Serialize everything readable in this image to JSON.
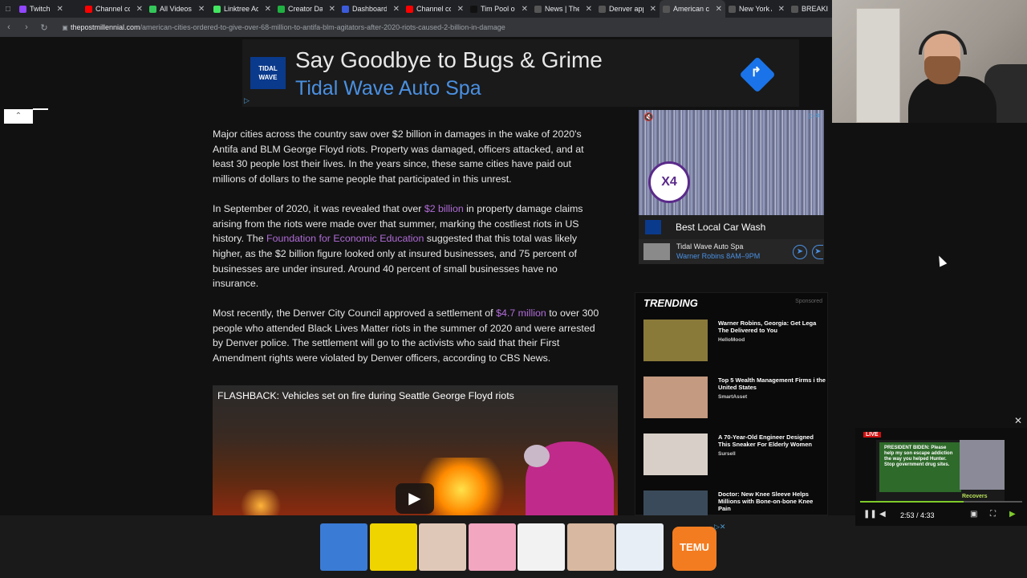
{
  "tabs": [
    {
      "label": "Twitch",
      "color": "#9146ff"
    },
    {
      "label": "Channel co",
      "color": "#ff0000"
    },
    {
      "label": "All Videos",
      "color": "#34c759"
    },
    {
      "label": "Linktree Ad",
      "color": "#43e660"
    },
    {
      "label": "Creator Da",
      "color": "#1fb141"
    },
    {
      "label": "Dashboard",
      "color": "#3b5bdb"
    },
    {
      "label": "Channel co",
      "color": "#ff0000"
    },
    {
      "label": "Tim Pool or",
      "color": "#111111"
    },
    {
      "label": "News | The",
      "color": "#555555"
    },
    {
      "label": "Denver app",
      "color": "#555555"
    },
    {
      "label": "American c",
      "color": "#555555",
      "active": true
    },
    {
      "label": "New York A",
      "color": "#555555"
    },
    {
      "label": "BREAKI",
      "color": "#555555"
    }
  ],
  "url": {
    "domain": "thepostmillennial.com",
    "path": "/american-cities-ordered-to-give-over-68-million-to-antifa-blm-agitators-after-2020-riots-caused-2-billion-in-damage"
  },
  "top_ad": {
    "logo": "TIDAL WAVE",
    "headline": "Say Goodbye to Bugs & Grime",
    "brand": "Tidal Wave Auto Spa",
    "arrow": "↱"
  },
  "article": {
    "p1": "Major cities across the country saw over $2 billion in damages in the wake of 2020's Antifa and BLM George Floyd riots. Property was damaged, officers attacked, and at least 30 people lost their lives. In the years since, these same cities have paid out millions of dollars to the same people that participated in this unrest.",
    "p2_a": "In September of 2020, it was revealed that over ",
    "p2_link1": "$2 billion",
    "p2_b": " in property damage claims arising from the riots were made over that summer, marking the costliest riots in US history. The ",
    "p2_link2": "Foundation for Economic Education",
    "p2_c": " suggested that this total was likely higher, as the $2 billion figure looked only at insured businesses, and 75 percent of businesses are under insured. Around 40 percent of small businesses have no insurance.",
    "p3_a": "Most recently, the Denver City Council approved a settlement of ",
    "p3_link": "$4.7 million",
    "p3_b": " to over 300 people who attended Black Lives Matter riots in the summer of 2020 and were arrested by Denver police. The settlement will go to the activists who said that their First Amendment rights were violated by Denver officers, according to CBS News."
  },
  "video": {
    "title": "FLASHBACK: Vehicles set on fire during Seattle George Floyd riots"
  },
  "side_ad": {
    "badge": "X4",
    "title": "Best Local Car Wash",
    "biz": "Tidal Wave Auto Spa",
    "location": "Warner Robins 8AM–9PM"
  },
  "trending": {
    "header": "TRENDING",
    "sponsored": "Sponsored",
    "items": [
      {
        "title": "Warner Robins, Georgia: Get Lega The Delivered to You",
        "source": "HelloMood",
        "img": "#8a7a3a"
      },
      {
        "title": "Top 5 Wealth Management Firms i the United States",
        "source": "SmartAsset",
        "img": "#c49a80"
      },
      {
        "title": "A 70-Year-Old Engineer Designed This Sneaker For Elderly Women",
        "source": "Sursell",
        "img": "#d8d0c8"
      },
      {
        "title": "Doctor: New Knee Sleeve Helps Millions with Bone-on-bone Knee Pain",
        "source": "",
        "img": "#3a4a5a"
      }
    ]
  },
  "bottom_bar": {
    "products": [
      "#3a7bd5",
      "#f0d400",
      "#e0c8b8",
      "#f2a6c0",
      "#f2f2f2",
      "#d8b8a0",
      "#e8eef5"
    ],
    "temu_label": "TEMU"
  },
  "pip": {
    "live": "LIVE",
    "text": "PRESIDENT BIDEN: Please help my son escape addiction the way you helped Hunter. Stop government drug sites.",
    "tag": "Recovers",
    "time": "2:53 / 4:33",
    "progress": 0.64
  }
}
